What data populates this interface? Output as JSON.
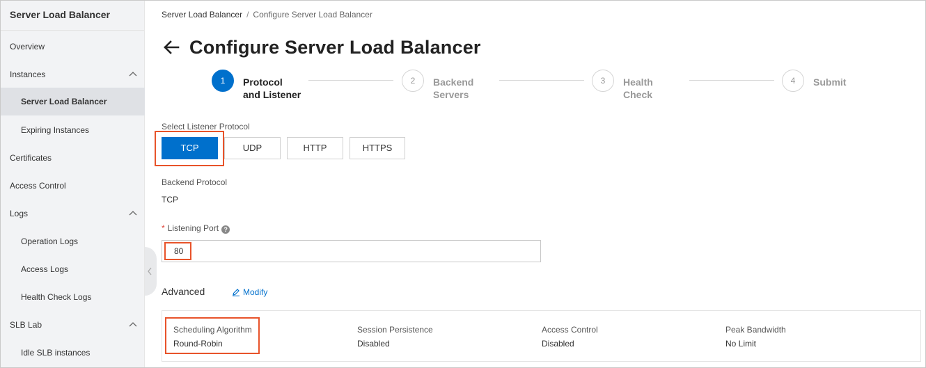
{
  "sidebar": {
    "title": "Server Load Balancer",
    "items": [
      {
        "label": "Overview"
      },
      {
        "label": "Instances"
      },
      {
        "label": "Server Load Balancer"
      },
      {
        "label": "Expiring Instances"
      },
      {
        "label": "Certificates"
      },
      {
        "label": "Access Control"
      },
      {
        "label": "Logs"
      },
      {
        "label": "Operation Logs"
      },
      {
        "label": "Access Logs"
      },
      {
        "label": "Health Check Logs"
      },
      {
        "label": "SLB Lab"
      },
      {
        "label": "Idle SLB instances"
      }
    ],
    "icons": {
      "collapse": "chevron-up-icon",
      "handle": "chevron-left-icon"
    }
  },
  "breadcrumb": {
    "root": "Server Load Balancer",
    "separator": "/",
    "current": "Configure Server Load Balancer"
  },
  "header": {
    "title": "Configure Server Load Balancer",
    "back_icon": "arrow-left-icon"
  },
  "steps": [
    {
      "number": "1",
      "line1": "Protocol",
      "line2": "and Listener",
      "active": true
    },
    {
      "number": "2",
      "line1": "Backend",
      "line2": "Servers",
      "active": false
    },
    {
      "number": "3",
      "line1": "Health",
      "line2": "Check",
      "active": false
    },
    {
      "number": "4",
      "line1": "Submit",
      "line2": "",
      "active": false
    }
  ],
  "form": {
    "listener_protocol_label": "Select Listener Protocol",
    "protocols": [
      "TCP",
      "UDP",
      "HTTP",
      "HTTPS"
    ],
    "selected_protocol": "TCP",
    "backend_protocol_label": "Backend Protocol",
    "backend_protocol_value": "TCP",
    "listening_port_required": "*",
    "listening_port_label": "Listening Port",
    "listening_port_help": "?",
    "listening_port_value": "80"
  },
  "advanced": {
    "label": "Advanced",
    "modify_label": "Modify",
    "modify_icon": "edit-icon",
    "fields": [
      {
        "key": "Scheduling Algorithm",
        "value": "Round-Robin"
      },
      {
        "key": "Session Persistence",
        "value": "Disabled"
      },
      {
        "key": "Access Control",
        "value": "Disabled"
      },
      {
        "key": "Peak Bandwidth",
        "value": "No Limit"
      }
    ]
  },
  "colors": {
    "primary": "#0070cc",
    "highlight": "#e8532a",
    "sidebar_bg": "#f2f3f5"
  }
}
